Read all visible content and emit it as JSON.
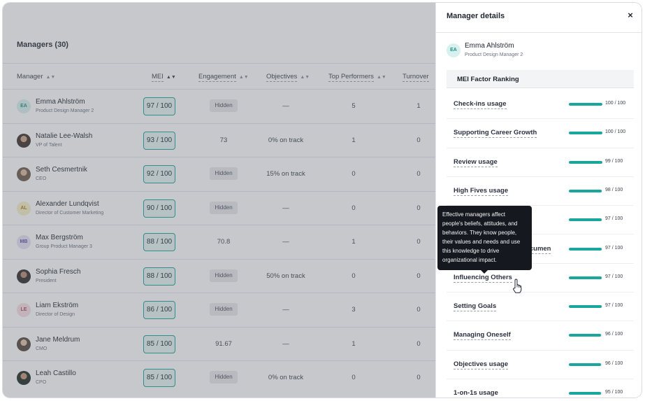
{
  "main": {
    "title": "Managers (30)",
    "columns": {
      "manager": "Manager",
      "mei": "MEI",
      "engagement": "Engagement",
      "objectives": "Objectives",
      "top_performers": "Top Performers",
      "turnover": "Turnover"
    },
    "rows": [
      {
        "initials": "EA",
        "name": "Emma Ahlström",
        "role": "Product Design Manager 2",
        "mei": "97 / 100",
        "engagement": "Hidden",
        "objectives": "—",
        "top_performers": "5",
        "turnover": "1"
      },
      {
        "initials": "",
        "name": "Natalie Lee-Walsh",
        "role": "VP of Talent",
        "mei": "93 / 100",
        "engagement": "73",
        "objectives": "0% on track",
        "top_performers": "1",
        "turnover": "0"
      },
      {
        "initials": "",
        "name": "Seth Cesmertnik",
        "role": "CEO",
        "mei": "92 / 100",
        "engagement": "Hidden",
        "objectives": "15% on track",
        "top_performers": "0",
        "turnover": "0"
      },
      {
        "initials": "AL",
        "name": "Alexander Lundqvist",
        "role": "Director of Customer Marketing",
        "mei": "90 / 100",
        "engagement": "Hidden",
        "objectives": "—",
        "top_performers": "0",
        "turnover": "0"
      },
      {
        "initials": "MB",
        "name": "Max Bergström",
        "role": "Group Product Manager 3",
        "mei": "88 / 100",
        "engagement": "70.8",
        "objectives": "—",
        "top_performers": "1",
        "turnover": "0"
      },
      {
        "initials": "",
        "name": "Sophia Fresch",
        "role": "President",
        "mei": "88 / 100",
        "engagement": "Hidden",
        "objectives": "50% on track",
        "top_performers": "0",
        "turnover": "0"
      },
      {
        "initials": "LE",
        "name": "Liam Ekström",
        "role": "Director of Design",
        "mei": "86 / 100",
        "engagement": "Hidden",
        "objectives": "—",
        "top_performers": "3",
        "turnover": "0"
      },
      {
        "initials": "",
        "name": "Jane Meldrum",
        "role": "CMO",
        "mei": "85 / 100",
        "engagement": "91.67",
        "objectives": "—",
        "top_performers": "1",
        "turnover": "0"
      },
      {
        "initials": "",
        "name": "Leah Castillo",
        "role": "CPO",
        "mei": "85 / 100",
        "engagement": "Hidden",
        "objectives": "0% on track",
        "top_performers": "0",
        "turnover": "0"
      }
    ]
  },
  "panel": {
    "title": "Manager details",
    "close": "×",
    "manager": {
      "initials": "EA",
      "name": "Emma Ahlström",
      "role": "Product Design Manager 2"
    },
    "ranking_title": "MEI Factor Ranking",
    "factors": [
      {
        "name": "Check-ins usage",
        "score": "100 / 100",
        "level": 1.0
      },
      {
        "name": "Supporting Career Growth",
        "score": "100 / 100",
        "level": 1.0
      },
      {
        "name": "Review usage",
        "score": "99 / 100",
        "level": 0.99
      },
      {
        "name": "High Fives usage",
        "score": "98 / 100",
        "level": 0.98
      },
      {
        "name": "",
        "score": "97 / 100",
        "level": 0.97
      },
      {
        "name": "Acumen",
        "score": "97 / 100",
        "level": 0.97
      },
      {
        "name": "Influencing Others",
        "score": "97 / 100",
        "level": 0.97
      },
      {
        "name": "Setting Goals",
        "score": "97 / 100",
        "level": 0.97
      },
      {
        "name": "Managing Oneself",
        "score": "96 / 100",
        "level": 0.96
      },
      {
        "name": "Objectives usage",
        "score": "96 / 100",
        "level": 0.96
      },
      {
        "name": "1-on-1s usage",
        "score": "95 / 100",
        "level": 0.95
      }
    ]
  },
  "tooltip": {
    "text": "Effective managers affect people's beliefs, attitudes, and behaviors. They know people, their values and needs and use this knowledge to drive organizational impact."
  },
  "colors": {
    "accent": "#19a69c",
    "overlay": "#606670"
  }
}
